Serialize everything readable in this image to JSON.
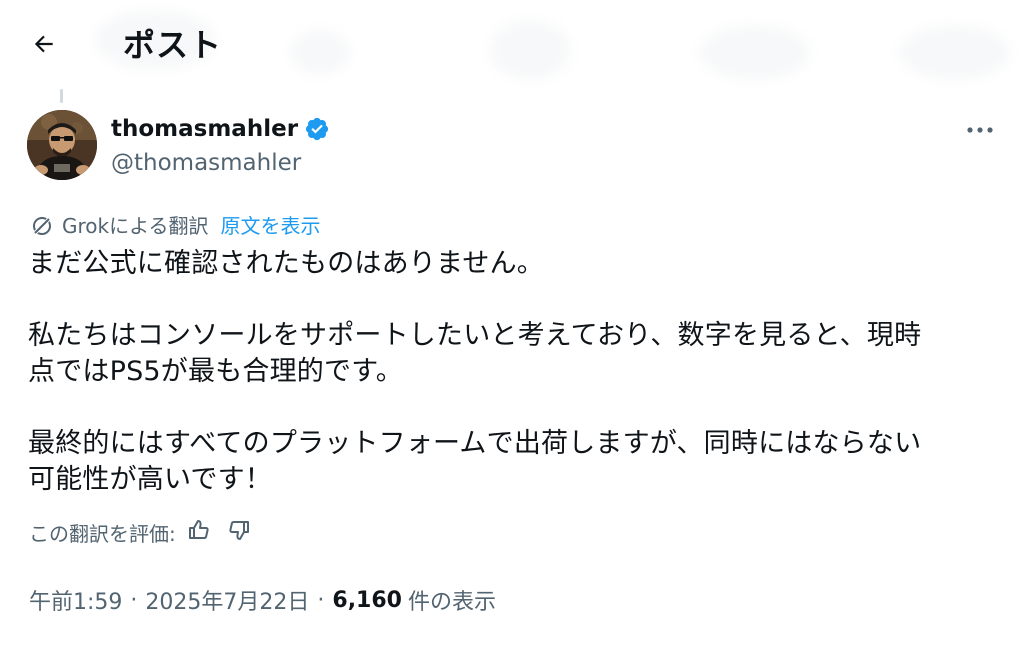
{
  "header": {
    "title": "ポスト"
  },
  "author": {
    "display_name": "thomasmahler",
    "handle": "@thomasmahler"
  },
  "translation": {
    "label": "Grokによる翻訳",
    "show_original": "原文を表示"
  },
  "post": {
    "paragraphs": [
      "まだ公式に確認されたものはありません。",
      "私たちはコンソールをサポートしたいと考えており、数字を見ると、現時\n点ではPS5が最も合理的です。",
      "最終的にはすべてのプラットフォームで出荷しますが、同時にはならない\n可能性が高いです！"
    ]
  },
  "rating": {
    "label": "この翻訳を評価:"
  },
  "meta": {
    "time": "午前1:59",
    "separator": "·",
    "date": "2025年7月22日",
    "views_count": "6,160",
    "views_label": "件の表示"
  },
  "colors": {
    "accent": "#1d9bf0",
    "text": "#0f1419",
    "secondary": "#536471",
    "verified": "#1d9bf0"
  },
  "icons": {
    "back": "arrow-left-icon",
    "verified": "verified-badge-icon",
    "more": "more-horizontal-icon",
    "grok": "grok-logo-icon",
    "thumbs_up": "thumbs-up-icon",
    "thumbs_down": "thumbs-down-icon"
  }
}
